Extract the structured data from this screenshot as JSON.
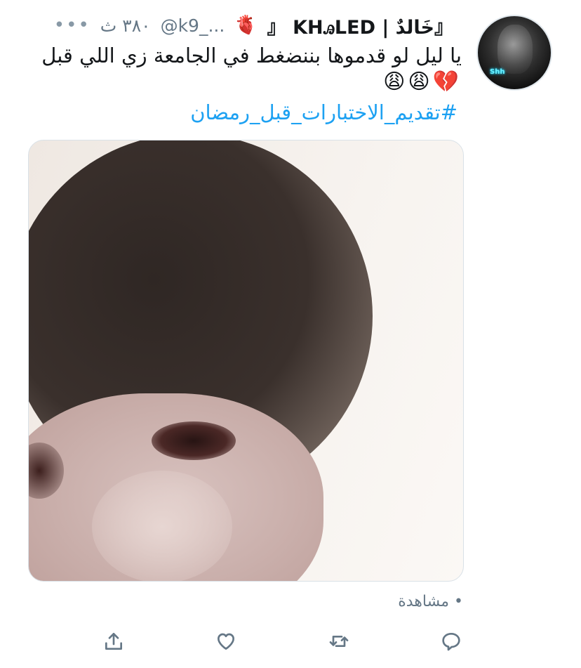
{
  "tweet": {
    "display_name": "『خَالدٌ | KHꭿLED 『",
    "name_emoji": "🫀",
    "handle": "@k9_...",
    "meta": "۳۸۰ ث",
    "more_label": "•••",
    "text": "يا ليل لو قدموها بننضغط في الجامعة زي اللي قبل",
    "emojis": "💔😩😩",
    "hashtag": "#تقديم_الاختبارات_قبل_رمضان",
    "views_label": "• مشاهدة",
    "avatar_text": "Shh"
  },
  "actions": [
    "reply-icon",
    "retweet-icon",
    "like-icon",
    "share-icon"
  ],
  "colors": {
    "link": "#1da1f2",
    "secondary_text": "#657786",
    "primary_text": "#14171a",
    "border": "#d9e1e7"
  }
}
